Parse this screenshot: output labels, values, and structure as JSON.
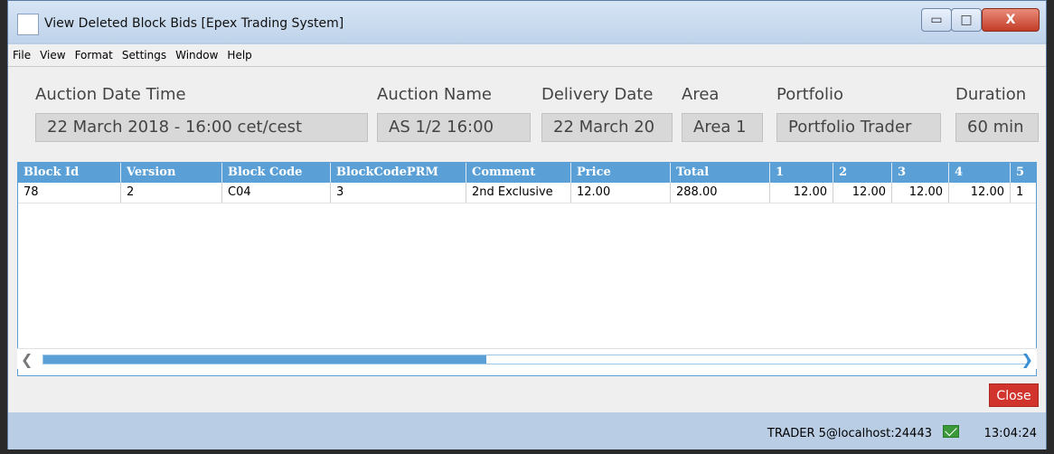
{
  "window": {
    "title": "View Deleted Block Bids [Epex Trading System]",
    "close_glyph": "X"
  },
  "menu": [
    "File",
    "View",
    "Format",
    "Settings",
    "Window",
    "Help"
  ],
  "fields": [
    {
      "label": "Auction Date Time",
      "value": "22 March 2018 - 16:00 cet/cest"
    },
    {
      "label": "Auction Name",
      "value": "AS 1/2 16:00"
    },
    {
      "label": "Delivery Date",
      "value": "22 March 20"
    },
    {
      "label": "Area",
      "value": "Area 1"
    },
    {
      "label": "Portfolio",
      "value": "Portfolio Trader"
    },
    {
      "label": "Duration",
      "value": "60 min"
    }
  ],
  "table": {
    "columns": [
      "Block Id",
      "Version",
      "Block Code",
      "BlockCodePRM",
      "Comment",
      "Price",
      "Total",
      "1",
      "2",
      "3",
      "4",
      "5"
    ],
    "rows": [
      [
        "78",
        "2",
        "C04",
        "3",
        "2nd Exclusive",
        "12.00",
        "288.00",
        "12.00",
        "12.00",
        "12.00",
        "12.00",
        "1"
      ]
    ]
  },
  "scrollbar": {
    "left_arrow": "❮",
    "right_arrow": "❯",
    "thumb_fraction": 0.45
  },
  "buttons": {
    "close": "Close"
  },
  "status": {
    "user": "TRADER 5@localhost:24443",
    "time": "13:04:24"
  },
  "colors": {
    "header": "#5aa0d7",
    "close_button": "#d0342c",
    "status_icon": "#3a9a3a"
  }
}
